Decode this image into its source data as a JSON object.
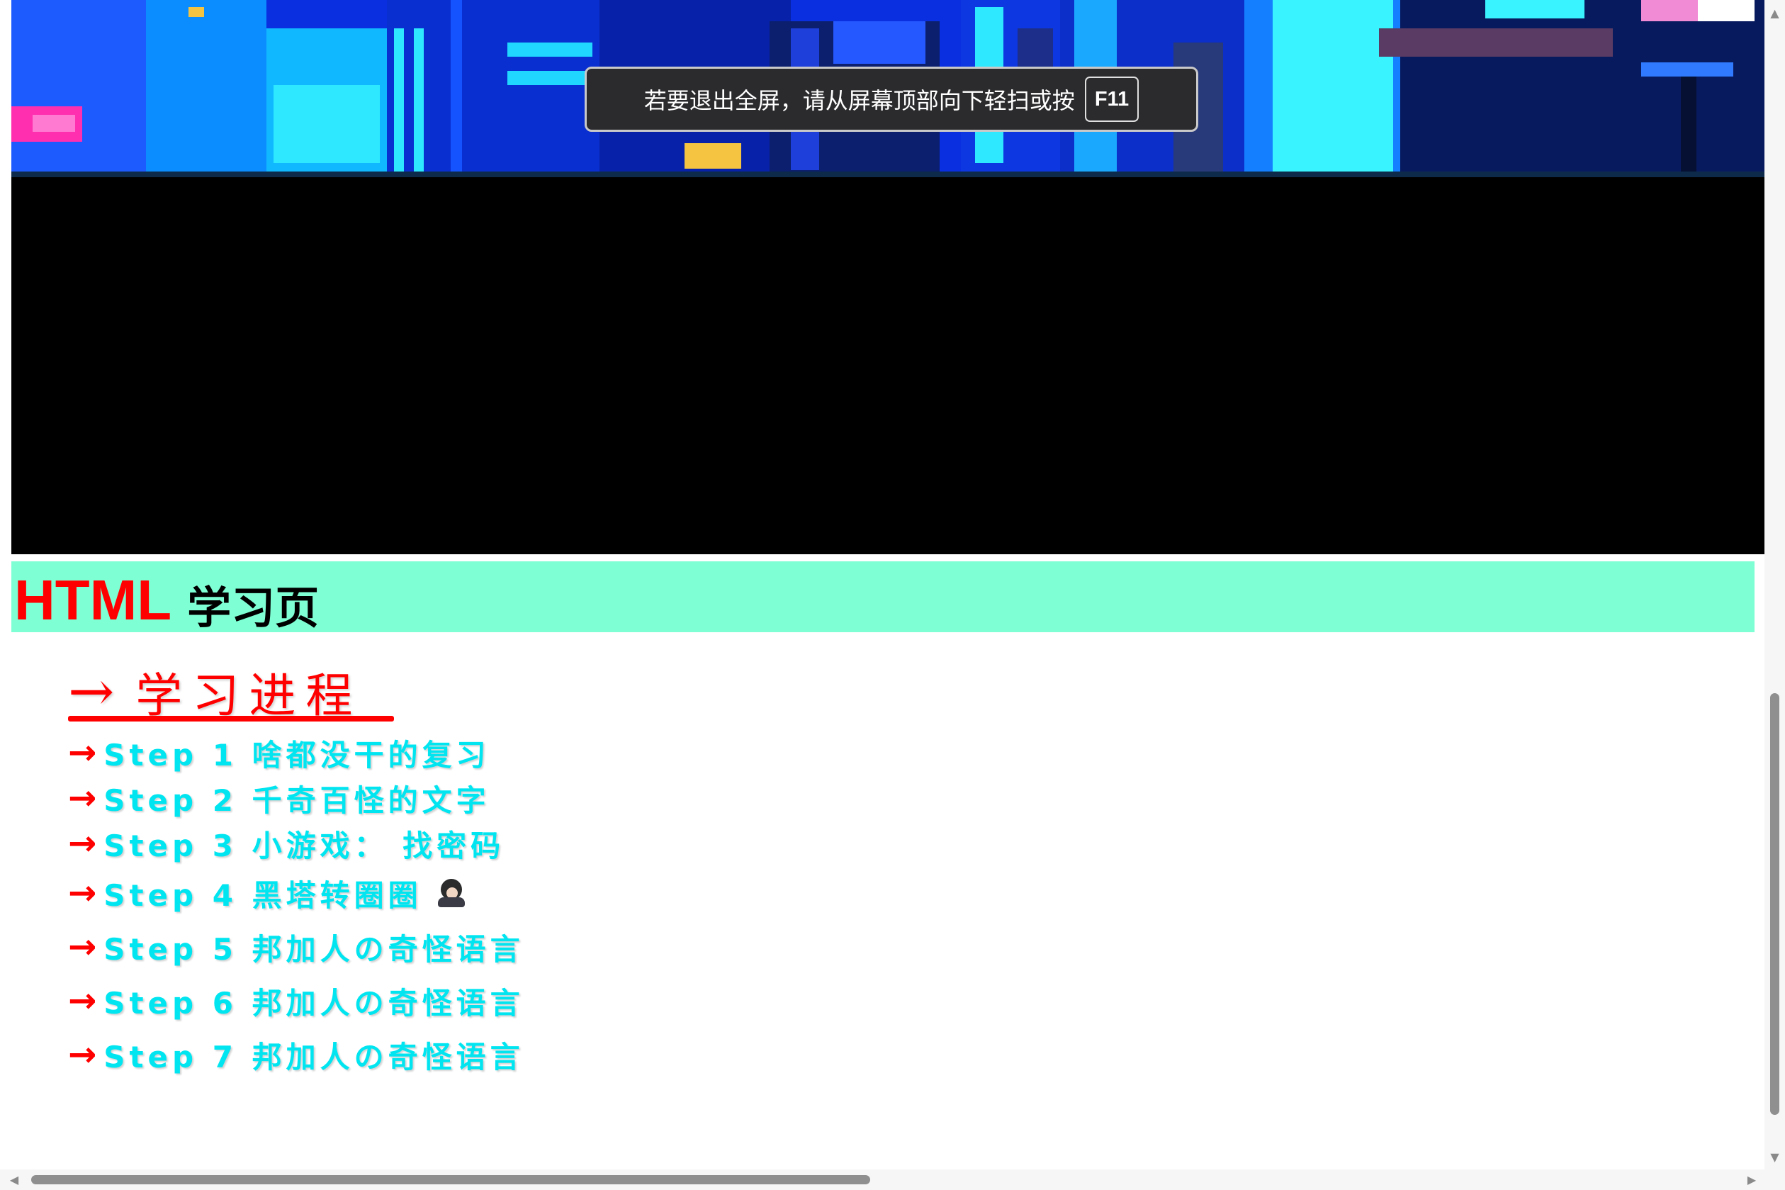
{
  "fullscreen_toast": {
    "message": "若要退出全屏，请从屏幕顶部向下轻扫或按",
    "key": "F11"
  },
  "header": {
    "title_main": "HTML",
    "title_sub": "学习页",
    "background": "#7fffd4"
  },
  "progress": {
    "arrow": "→",
    "heading": "学习进程",
    "steps": [
      {
        "arrow": "→",
        "label": "Step 1 啥都没干的复习"
      },
      {
        "arrow": "→",
        "label": "Step 2 千奇百怪的文字"
      },
      {
        "arrow": "→",
        "label": "Step 3 小游戏： 找密码"
      },
      {
        "arrow": "→",
        "label": "Step 4 黑塔转圈圈"
      },
      {
        "arrow": "→",
        "label": "Step 5 邦加人の奇怪语言"
      },
      {
        "arrow": "→",
        "label": "Step 6 邦加人の奇怪语言"
      },
      {
        "arrow": "→",
        "label": "Step 7 邦加人の奇怪语言"
      }
    ]
  },
  "colors": {
    "title_red": "#ff0000",
    "step_cyan": "#00e5f0",
    "banner_blue": "#0a2fe0"
  },
  "icons": {
    "step4_avatar": "character-avatar-icon",
    "scroll_up": "chevron-up-icon",
    "scroll_down": "chevron-down-icon",
    "scroll_left": "chevron-left-icon",
    "scroll_right": "chevron-right-icon"
  }
}
